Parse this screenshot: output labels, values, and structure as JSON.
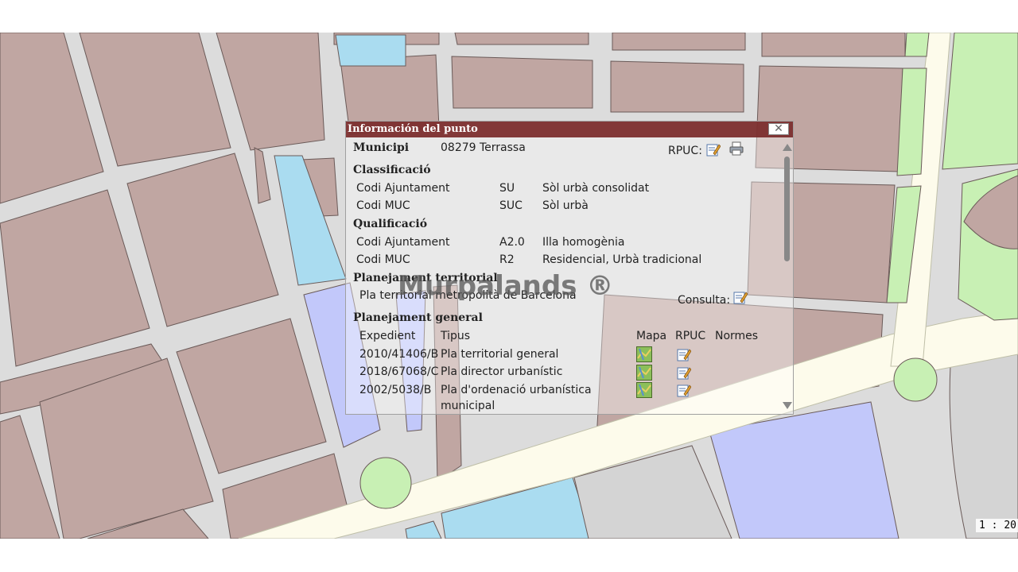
{
  "window": {
    "title": "Información del punto",
    "close_symbol": "✕"
  },
  "municipi": {
    "label": "Municipi",
    "value": "08279 Terrassa",
    "rpuc_label": "RPUC:"
  },
  "classificacio": {
    "heading": "Classificació",
    "rows": [
      {
        "label": "Codi Ajuntament",
        "code": "SU",
        "desc": "Sòl urbà consolidat"
      },
      {
        "label": "Codi MUC",
        "code": "SUC",
        "desc": "Sòl urbà"
      }
    ]
  },
  "qualificacio": {
    "heading": "Qualificació",
    "rows": [
      {
        "label": "Codi Ajuntament",
        "code": "A2.0",
        "desc": "Illa homogènia"
      },
      {
        "label": "Codi MUC",
        "code": "R2",
        "desc": "Residencial, Urbà tradicional"
      }
    ]
  },
  "planejament_territorial": {
    "heading": "Planejament territorial",
    "plan": "Pla territorial metropolità de Barcelona",
    "consulta_label": "Consulta:"
  },
  "planejament_general": {
    "heading": "Planejament general",
    "columns": [
      "Expedient",
      "Tipus",
      "Mapa",
      "RPUC",
      "Normes"
    ],
    "rows": [
      {
        "expedient": "2010/41406/B",
        "tipus": "Pla territorial general",
        "tipus_cont": ""
      },
      {
        "expedient": "2018/67068/C",
        "tipus": "Pla director urbanístic",
        "tipus_cont": ""
      },
      {
        "expedient": "2002/5038/B",
        "tipus": "Pla d'ordenació urbanística",
        "tipus_cont": "municipal"
      }
    ]
  },
  "map": {
    "scale_text": "1 : 20",
    "colors": {
      "block": "#c0a6a2",
      "street": "#dcdcdc",
      "water": "#aadcf0",
      "park": "#c8f0b4",
      "lavender": "#c2c8fa",
      "gray": "#d4d4d4",
      "road": "#fdfbeb"
    }
  },
  "watermark": "Murpalands ®",
  "icons": {
    "edit": "edit-document-icon",
    "print": "printer-icon",
    "map": "map-icon"
  }
}
